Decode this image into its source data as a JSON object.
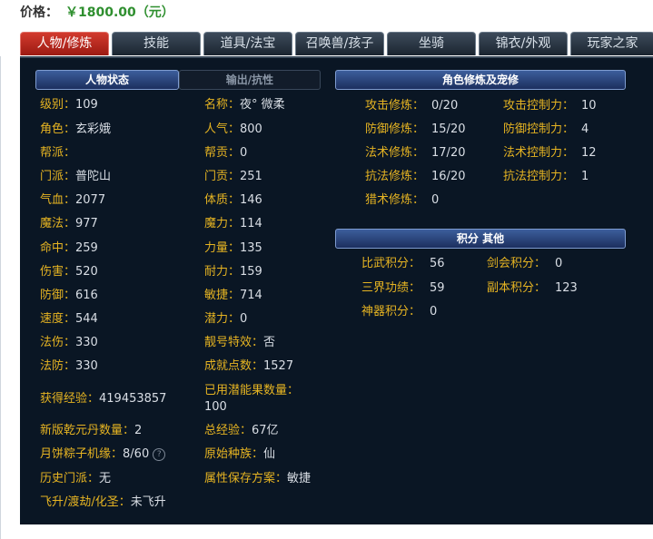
{
  "price": {
    "label": "价格：",
    "value": "￥1800.00",
    "unit": "（元）"
  },
  "tabs": [
    {
      "label": "人物/修炼",
      "active": true
    },
    {
      "label": "技能",
      "active": false
    },
    {
      "label": "道具/法宝",
      "active": false
    },
    {
      "label": "召唤兽/孩子",
      "active": false
    },
    {
      "label": "坐骑",
      "active": false
    },
    {
      "label": "锦衣/外观",
      "active": false
    },
    {
      "label": "玩家之家",
      "active": false
    }
  ],
  "sections": {
    "status": "人物状态",
    "output": "输出/抗性",
    "cultivation": "角色修炼及宠修",
    "points": "积分 其他"
  },
  "left": [
    {
      "label": "级别：",
      "value": "109"
    },
    {
      "label": "角色：",
      "value": "玄彩娥"
    },
    {
      "label": "帮派：",
      "value": ""
    },
    {
      "label": "门派：",
      "value": "普陀山"
    },
    {
      "label": "气血：",
      "value": "2077"
    },
    {
      "label": "魔法：",
      "value": "977"
    },
    {
      "label": "命中：",
      "value": "259"
    },
    {
      "label": "伤害：",
      "value": "520"
    },
    {
      "label": "防御：",
      "value": "616"
    },
    {
      "label": "速度：",
      "value": "544"
    },
    {
      "label": "法伤：",
      "value": "330"
    },
    {
      "label": "法防：",
      "value": "330"
    },
    {
      "label": "获得经验：",
      "value": "419453857"
    },
    {
      "label": "新版乾元丹数量：",
      "value": "2"
    },
    {
      "label": "月饼粽子机缘：",
      "value": "8/60"
    },
    {
      "label": "历史门派：",
      "value": "无"
    },
    {
      "label": "飞升/渡劫/化圣：",
      "value": "未飞升"
    }
  ],
  "right": [
    {
      "label": "名称：",
      "value": "夜° 微柔"
    },
    {
      "label": "人气：",
      "value": "800"
    },
    {
      "label": "帮贡：",
      "value": "0"
    },
    {
      "label": "门贡：",
      "value": "251"
    },
    {
      "label": "体质：",
      "value": "146"
    },
    {
      "label": "魔力：",
      "value": "114"
    },
    {
      "label": "力量：",
      "value": "135"
    },
    {
      "label": "耐力：",
      "value": "159"
    },
    {
      "label": "敏捷：",
      "value": "714"
    },
    {
      "label": "潜力：",
      "value": "0"
    },
    {
      "label": "靓号特效：",
      "value": "否"
    },
    {
      "label": "成就点数：",
      "value": "1527"
    },
    {
      "label": "已用潜能果数量：",
      "value": "100"
    },
    {
      "label": "总经验：",
      "value": "67亿"
    },
    {
      "label": "原始种族：",
      "value": "仙"
    },
    {
      "label": "属性保存方案：",
      "value": "敏捷"
    }
  ],
  "cultivation": [
    {
      "label": "攻击修炼：",
      "value": "0/20",
      "label2": "攻击控制力：",
      "value2": "10"
    },
    {
      "label": "防御修炼：",
      "value": "15/20",
      "label2": "防御控制力：",
      "value2": "4"
    },
    {
      "label": "法术修炼：",
      "value": "17/20",
      "label2": "法术控制力：",
      "value2": "12"
    },
    {
      "label": "抗法修炼：",
      "value": "16/20",
      "label2": "抗法控制力：",
      "value2": "1"
    },
    {
      "label": "猎术修炼：",
      "value": "0"
    }
  ],
  "points": [
    {
      "label": "比武积分：",
      "value": "56",
      "label2": "剑会积分：",
      "value2": "0"
    },
    {
      "label": "三界功绩：",
      "value": "59",
      "label2": "副本积分：",
      "value2": "123"
    },
    {
      "label": "神器积分：",
      "value": "0"
    }
  ],
  "colors": {
    "label": "#e6b422",
    "value": "#d9dee5",
    "price": "#2f8f2f",
    "active_tab": "#c0302a",
    "panel": "#0a1624"
  },
  "icons": {
    "help": "question-circle-icon"
  }
}
